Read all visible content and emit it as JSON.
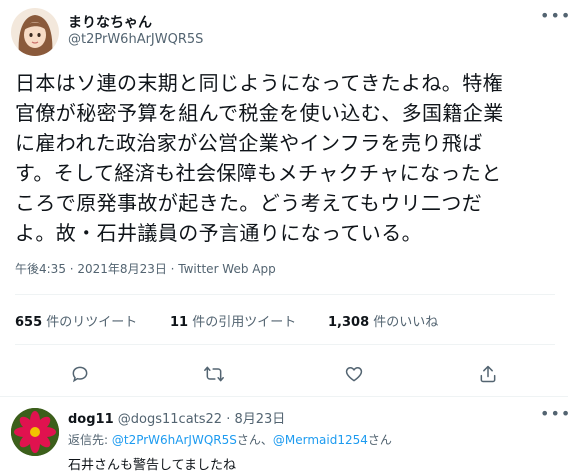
{
  "tweet": {
    "display_name": "まりなちゃん",
    "handle": "@t2PrW6hArJWQR5S",
    "text": "日本はソ連の末期と同じようになってきたよね。特権\n官僚が秘密予算を組んで税金を使い込む、多国籍企業\nに雇われた政治家が公営企業やインフラを売り飛ば\nす。そして経済も社会保障もメチャクチャになったと\nころで原発事故が起きた。どう考えてもウリ二つだ\nよ。故・石井議員の予言通りになっている。",
    "meta": "午後4:35 · 2021年8月23日 · Twitter Web App",
    "more_icon": "more-icon"
  },
  "stats": {
    "retweets_count": "655",
    "retweets_label": "件のリツイート",
    "quotes_count": "11",
    "quotes_label": "件の引用ツイート",
    "likes_count": "1,308",
    "likes_label": "件のいいね"
  },
  "actions": [
    "reply-icon",
    "retweet-icon",
    "like-icon",
    "share-icon"
  ],
  "reply": {
    "display_name": "dog11",
    "handle": "@dogs11cats22",
    "date": "· 8月23日",
    "replying_to_label": "返信先:",
    "mention1": "@t2PrW6hArJWQR5S",
    "san1": "さん、",
    "mention2": "@Mermaid1254",
    "san2": "さん",
    "text": "石井さんも警告してましたね"
  },
  "colors": {
    "link": "#1d9bf0",
    "secondary": "#536471",
    "divider": "#eff3f4"
  }
}
